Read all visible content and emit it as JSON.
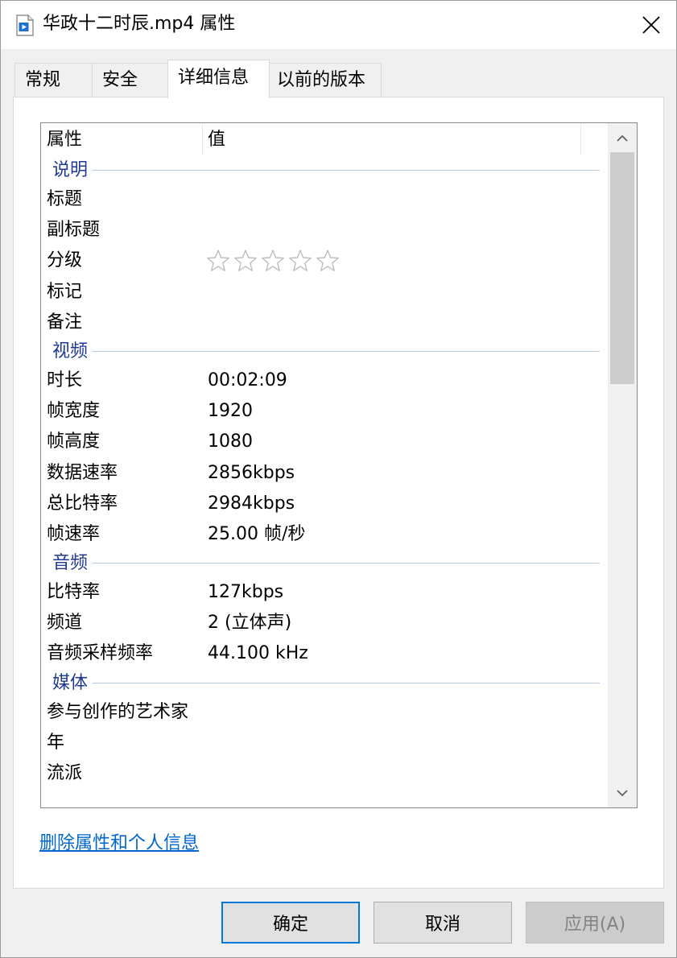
{
  "window": {
    "title": "华政十二时辰.mp4 属性",
    "icon": "video-file-icon",
    "close_icon": "close-icon"
  },
  "tabs": [
    {
      "label": "常规",
      "active": false
    },
    {
      "label": "安全",
      "active": false
    },
    {
      "label": "详细信息",
      "active": true
    },
    {
      "label": "以前的版本",
      "active": false
    }
  ],
  "details": {
    "columns": {
      "property": "属性",
      "value": "值"
    },
    "groups": {
      "description": {
        "label": "说明",
        "rows": [
          {
            "name": "标题",
            "value": ""
          },
          {
            "name": "副标题",
            "value": ""
          },
          {
            "name": "分级",
            "rating_stars": 0,
            "rating_max": 5
          },
          {
            "name": "标记",
            "value": ""
          },
          {
            "name": "备注",
            "value": ""
          }
        ]
      },
      "video": {
        "label": "视频",
        "rows": [
          {
            "name": "时长",
            "value": "00:02:09"
          },
          {
            "name": "帧宽度",
            "value": "1920"
          },
          {
            "name": "帧高度",
            "value": "1080"
          },
          {
            "name": "数据速率",
            "value": "2856kbps"
          },
          {
            "name": "总比特率",
            "value": "2984kbps"
          },
          {
            "name": "帧速率",
            "value": "25.00 帧/秒"
          }
        ]
      },
      "audio": {
        "label": "音频",
        "rows": [
          {
            "name": "比特率",
            "value": "127kbps"
          },
          {
            "name": "频道",
            "value": "2 (立体声)"
          },
          {
            "name": "音频采样频率",
            "value": "44.100 kHz"
          }
        ]
      },
      "media": {
        "label": "媒体",
        "rows": [
          {
            "name": "参与创作的艺术家",
            "value": ""
          },
          {
            "name": "年",
            "value": ""
          },
          {
            "name": "流派",
            "value": ""
          }
        ]
      }
    }
  },
  "link": {
    "label": "删除属性和个人信息"
  },
  "buttons": {
    "ok": "确定",
    "cancel": "取消",
    "apply": "应用(A)",
    "apply_enabled": false
  },
  "colors": {
    "group_label": "#1e3b91",
    "link": "#0066cc",
    "default_button_border": "#0078d7"
  }
}
